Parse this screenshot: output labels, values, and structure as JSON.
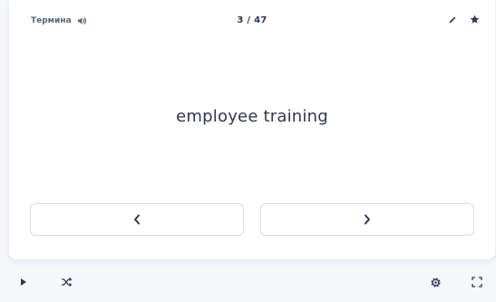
{
  "card": {
    "side_label": "Термина",
    "counter": "3 / 47",
    "term": "employee training"
  },
  "icons": {
    "audio": "speaker-icon",
    "edit": "pencil-icon",
    "star": "star-icon",
    "prev": "chevron-left-icon",
    "next": "chevron-right-icon",
    "play": "play-icon",
    "shuffle": "shuffle-icon",
    "settings": "gear-icon",
    "fullscreen": "fullscreen-icon"
  },
  "colors": {
    "text_primary": "#2e3856",
    "text_secondary": "#586380",
    "border": "#d9dde8",
    "background": "#f6f7fb",
    "card": "#ffffff"
  }
}
